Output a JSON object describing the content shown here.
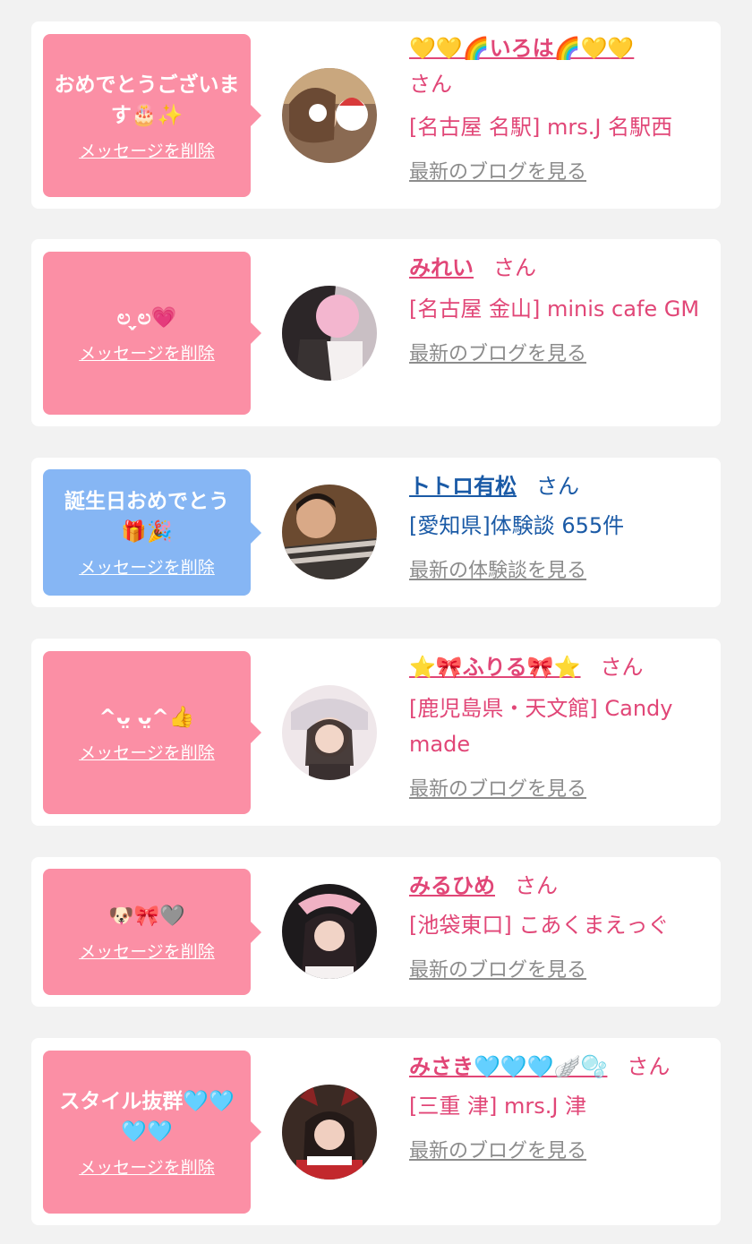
{
  "cards": [
    {
      "message": "おめでとうございます🎂✨",
      "delete_label": "メッセージを削除",
      "name": "💛💛🌈いろは🌈💛💛",
      "san": "さん",
      "shop": "[名古屋 名駅] mrs.J 名駅西",
      "blog_link": "最新のブログを見る"
    },
    {
      "message": "ಲ ̖̖̗̗̗̗ಲ💗",
      "delete_label": "メッセージを削除",
      "name": "みれい",
      "san": "さん",
      "shop": "[名古屋 金山] minis cafe GM",
      "blog_link": "最新のブログを見る"
    },
    {
      "message": "誕生日おめでとう🎁🎉",
      "delete_label": "メッセージを削除",
      "name": "トトロ有松",
      "san": "さん",
      "shop": "[愛知県]体験談 655件",
      "blog_link": "最新の体験談を見る"
    },
    {
      "message": "^ᴗ̤ ᴗ̤^👍",
      "delete_label": "メッセージを削除",
      "name": "⭐🎀ふりる🎀⭐",
      "san": "さん",
      "shop": "[鹿児島県・天文館] Candy made",
      "blog_link": "最新のブログを見る"
    },
    {
      "message": "🐶🎀🩶",
      "delete_label": "メッセージを削除",
      "name": "みるひめ",
      "san": "さん",
      "shop": "[池袋東口] こあくまえっぐ",
      "blog_link": "最新のブログを見る"
    },
    {
      "message": "スタイル抜群🩵🩵🩵🩵",
      "delete_label": "メッセージを削除",
      "name": "みさき🩵🩵🩵🪽🫧",
      "san": "さん",
      "shop": "[三重 津] mrs.J 津",
      "blog_link": "最新のブログを見る"
    }
  ],
  "colors": {
    "pink_bubble": "#fb8fa5",
    "blue_bubble": "#86b6f4",
    "pink_text": "#e14677",
    "blue_text": "#1a5aa6",
    "link_gray": "#8c8c8c"
  }
}
